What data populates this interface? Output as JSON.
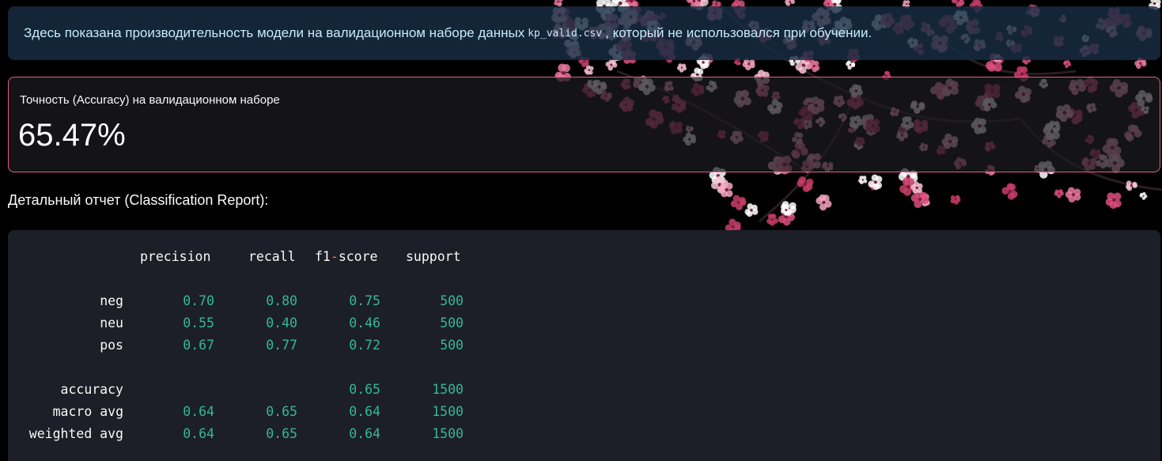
{
  "info": {
    "text_before": "Здесь показана производительность модели на валидационном наборе данных",
    "code": "kp_valid.csv",
    "text_after": ", который не использовался при обучении."
  },
  "metric": {
    "label": "Точность (Accuracy) на валидационном наборе",
    "value": "65.47%"
  },
  "report_heading": "Детальный отчет (Classification Report):",
  "report": {
    "headers": {
      "precision": "precision",
      "recall": "recall",
      "f1_prefix": "f1",
      "f1_dash": "-",
      "f1_suffix": "score",
      "support": "support"
    },
    "rows": [
      {
        "label": "neg",
        "precision": "0.70",
        "recall": "0.80",
        "f1": "0.75",
        "support": "500"
      },
      {
        "label": "neu",
        "precision": "0.55",
        "recall": "0.40",
        "f1": "0.46",
        "support": "500"
      },
      {
        "label": "pos",
        "precision": "0.67",
        "recall": "0.77",
        "f1": "0.72",
        "support": "500"
      },
      {
        "label": "accuracy",
        "precision": "",
        "recall": "",
        "f1": "0.65",
        "support": "1500"
      },
      {
        "label": "macro avg",
        "precision": "0.64",
        "recall": "0.65",
        "f1": "0.64",
        "support": "1500"
      },
      {
        "label": "weighted avg",
        "precision": "0.64",
        "recall": "0.65",
        "f1": "0.64",
        "support": "1500"
      }
    ]
  },
  "colors": {
    "info_bg": "#172d43",
    "info_text": "#c7ebff",
    "metric_border": "#e0608d",
    "code_bg": "#1c1f27",
    "number_color": "#34b89a",
    "operator_color": "#ff6b4a"
  },
  "background_image": "cherry-blossom-branch"
}
